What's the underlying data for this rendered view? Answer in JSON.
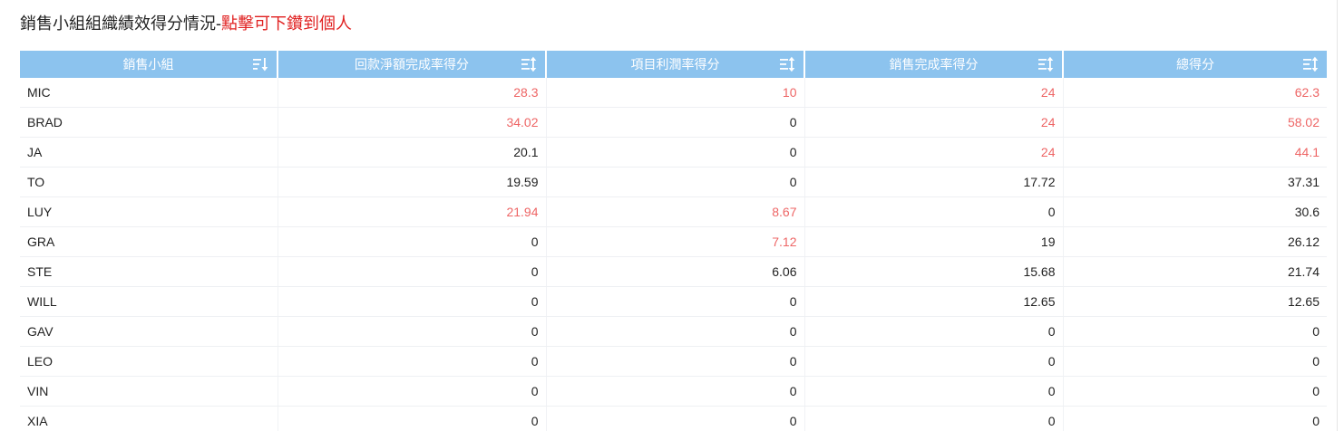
{
  "header": {
    "title_main": "銷售小組組織績效得分情況-",
    "title_link": "點擊可下鑽到個人"
  },
  "colors": {
    "header_bg": "#8cc3ee",
    "highlight_value": "#ee6666",
    "title_link": "#e02020"
  },
  "table": {
    "columns": [
      {
        "label": "銷售小組",
        "sort_icon": "sort-descending-icon"
      },
      {
        "label": "回款淨額完成率得分",
        "sort_icon": "sort-icon"
      },
      {
        "label": "項目利潤率得分",
        "sort_icon": "sort-icon"
      },
      {
        "label": "銷售完成率得分",
        "sort_icon": "sort-icon"
      },
      {
        "label": "總得分",
        "sort_icon": "sort-icon"
      }
    ],
    "rows": [
      {
        "cells": [
          "MIC",
          "28.3",
          "10",
          "24",
          "62.3"
        ],
        "highlight": [
          false,
          true,
          true,
          true,
          true
        ]
      },
      {
        "cells": [
          "BRAD",
          "34.02",
          "0",
          "24",
          "58.02"
        ],
        "highlight": [
          false,
          true,
          false,
          true,
          true
        ]
      },
      {
        "cells": [
          "JA",
          "20.1",
          "0",
          "24",
          "44.1"
        ],
        "highlight": [
          false,
          false,
          false,
          true,
          true
        ]
      },
      {
        "cells": [
          "TO",
          "19.59",
          "0",
          "17.72",
          "37.31"
        ],
        "highlight": [
          false,
          false,
          false,
          false,
          false
        ]
      },
      {
        "cells": [
          "LUY",
          "21.94",
          "8.67",
          "0",
          "30.6"
        ],
        "highlight": [
          false,
          true,
          true,
          false,
          false
        ]
      },
      {
        "cells": [
          "GRA",
          "0",
          "7.12",
          "19",
          "26.12"
        ],
        "highlight": [
          false,
          false,
          true,
          false,
          false
        ]
      },
      {
        "cells": [
          "STE",
          "0",
          "6.06",
          "15.68",
          "21.74"
        ],
        "highlight": [
          false,
          false,
          false,
          false,
          false
        ]
      },
      {
        "cells": [
          "WILL",
          "0",
          "0",
          "12.65",
          "12.65"
        ],
        "highlight": [
          false,
          false,
          false,
          false,
          false
        ]
      },
      {
        "cells": [
          "GAV",
          "0",
          "0",
          "0",
          "0"
        ],
        "highlight": [
          false,
          false,
          false,
          false,
          false
        ]
      },
      {
        "cells": [
          "LEO",
          "0",
          "0",
          "0",
          "0"
        ],
        "highlight": [
          false,
          false,
          false,
          false,
          false
        ]
      },
      {
        "cells": [
          "VIN",
          "0",
          "0",
          "0",
          "0"
        ],
        "highlight": [
          false,
          false,
          false,
          false,
          false
        ]
      },
      {
        "cells": [
          "XIA",
          "0",
          "0",
          "0",
          "0"
        ],
        "highlight": [
          false,
          false,
          false,
          false,
          false
        ]
      }
    ]
  }
}
